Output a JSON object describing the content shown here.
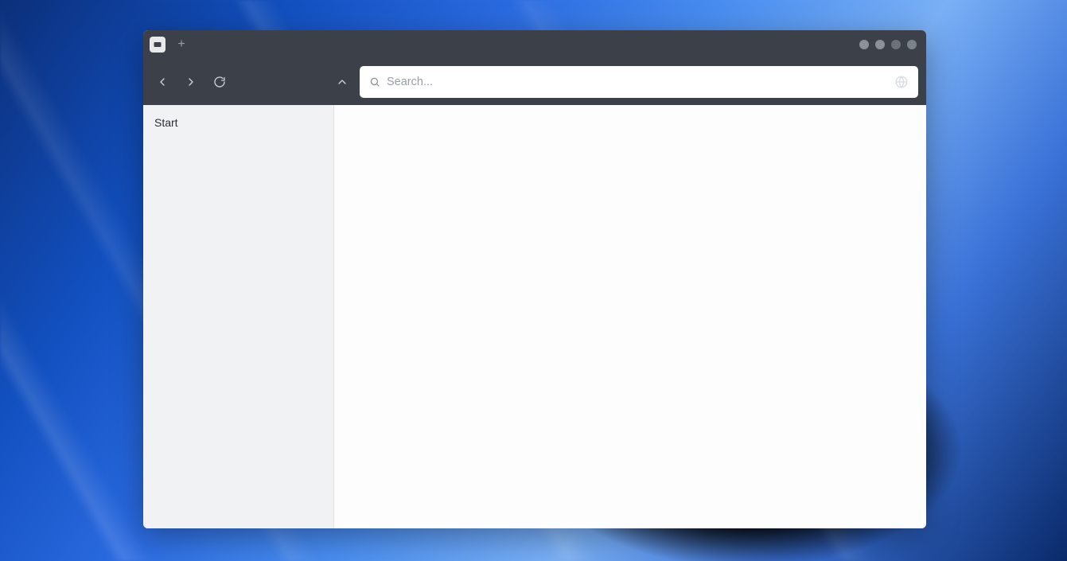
{
  "titlebar": {
    "new_tab_label": "+"
  },
  "toolbar": {
    "search_placeholder": "Search..."
  },
  "sidebar": {
    "items": [
      {
        "label": "Start"
      }
    ]
  }
}
